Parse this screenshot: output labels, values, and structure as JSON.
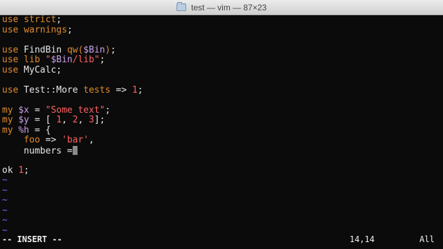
{
  "window": {
    "title": "test — vim — 87×23"
  },
  "buffer": {
    "lines": [
      "use strict;",
      "use warnings;",
      "",
      "use FindBin qw($Bin);",
      "use lib \"$Bin/lib\";",
      "use MyCalc;",
      "",
      "use Test::More tests => 1;",
      "",
      "my $x = \"Some text\";",
      "my $y = [ 1, 2, 3];",
      "my %h = {",
      "    foo => 'bar',",
      "    numbers =",
      "",
      "ok 1;",
      "~",
      "~",
      "~",
      "~",
      "~",
      "~"
    ]
  },
  "status": {
    "mode": "-- INSERT --",
    "position": "14,14",
    "scroll": "All"
  },
  "colors": {
    "keyword": "#e08a2e",
    "variable": "#c9a0e9",
    "string": "#ff6262",
    "tilde": "#6b6bff",
    "background": "#0b0b0b"
  }
}
